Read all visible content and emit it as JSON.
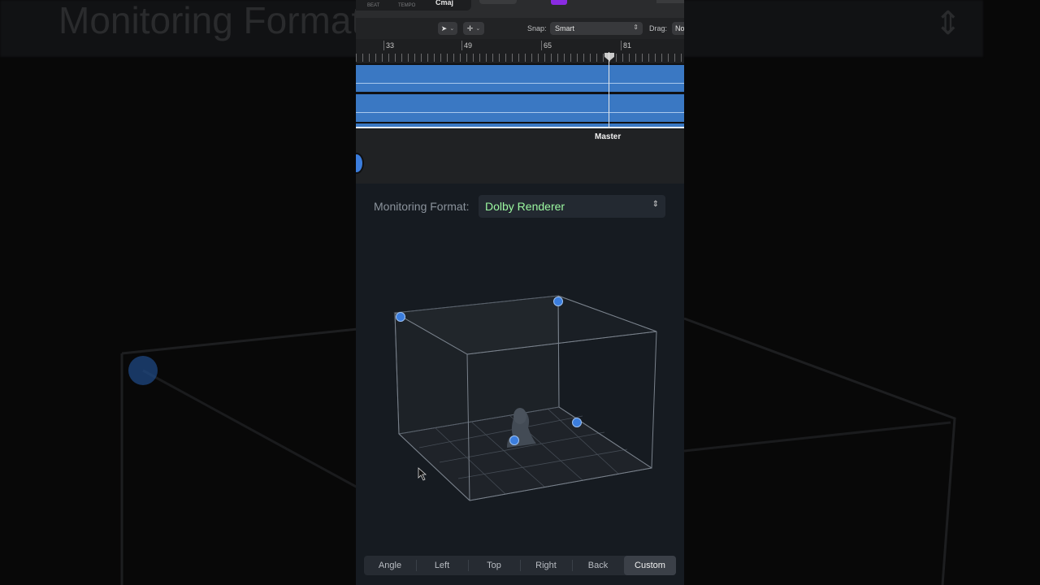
{
  "background": {
    "title_echo": "Monitoring Format"
  },
  "toolbar_top": {
    "beat_label": "BEAT",
    "tempo_label": "TEMPO",
    "key": "Cmaj",
    "accent_color": "#8a2be2"
  },
  "toolbar": {
    "pointer_tool_icon": "pointer-arrow-icon",
    "secondary_tool_icon": "crosshair-icon",
    "snap_label": "Snap:",
    "snap_value": "Smart",
    "drag_label": "Drag:",
    "drag_value": "No"
  },
  "ruler": {
    "markers": [
      "33",
      "49",
      "65",
      "81"
    ]
  },
  "timeline": {
    "track_color": "#3a78c3",
    "master_label": "Master"
  },
  "monitoring": {
    "label": "Monitoring Format:",
    "value": "Dolby Renderer",
    "value_color": "#9bf7a0"
  },
  "viewer": {
    "object_color": "#3b7ddd",
    "objects": [
      "object-1",
      "object-2",
      "object-3",
      "object-4"
    ]
  },
  "view_tabs": {
    "items": [
      "Angle",
      "Left",
      "Top",
      "Right",
      "Back",
      "Custom"
    ],
    "active": "Custom"
  }
}
